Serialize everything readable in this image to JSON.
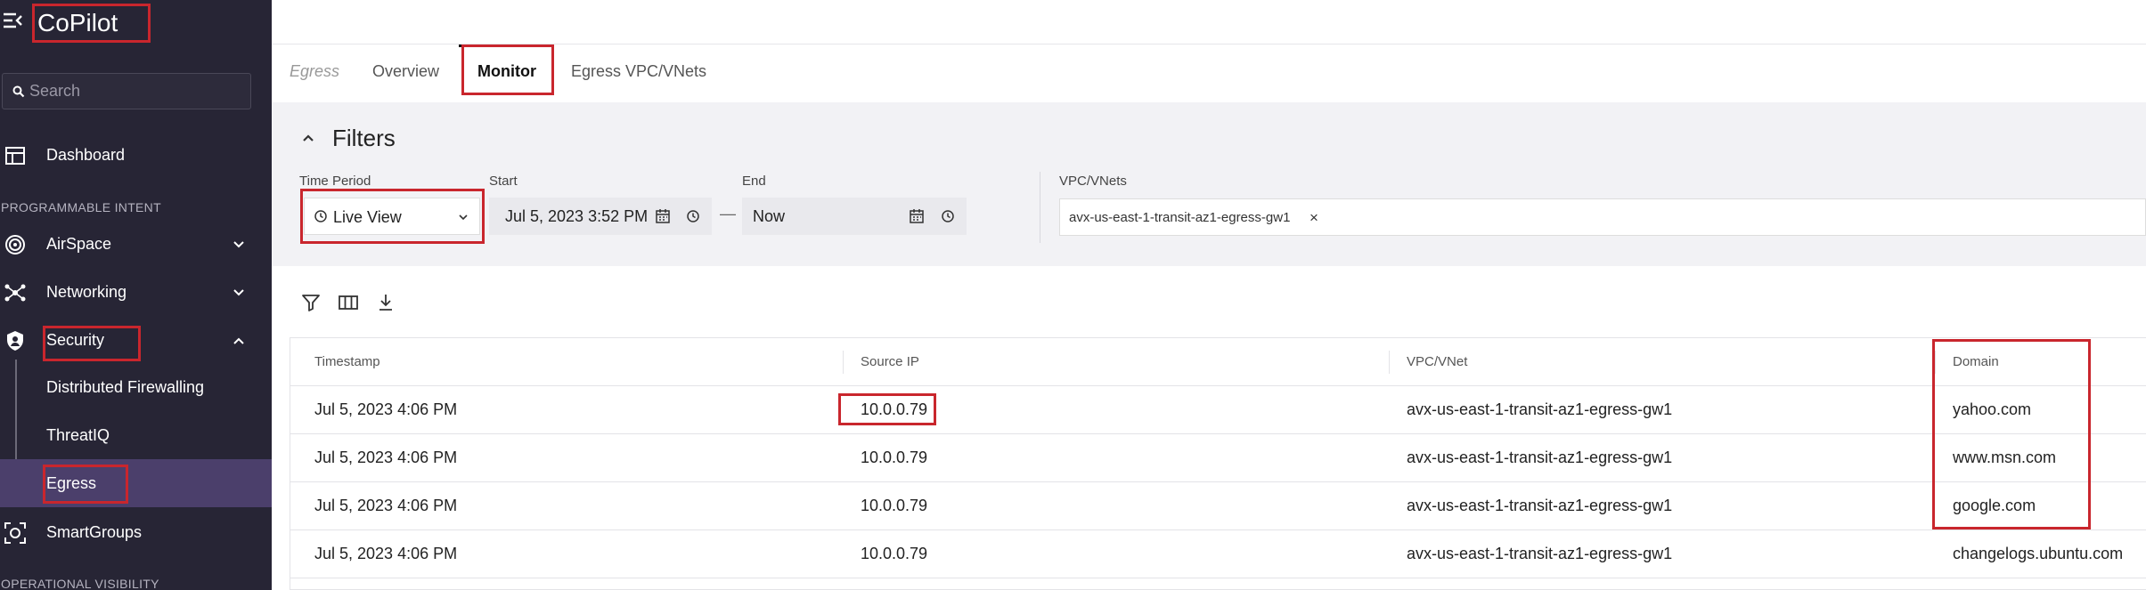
{
  "app": {
    "title": "CoPilot"
  },
  "search": {
    "placeholder": "Search"
  },
  "nav": {
    "dashboard": "Dashboard",
    "section_programmable": "PROGRAMMABLE INTENT",
    "airspace": "AirSpace",
    "networking": "Networking",
    "security": "Security",
    "security_items": [
      "Distributed Firewalling",
      "ThreatIQ",
      "Egress"
    ],
    "smartgroups": "SmartGroups",
    "section_operational": "OPERATIONAL VISIBILITY"
  },
  "tabs": {
    "breadcrumb": "Egress",
    "overview": "Overview",
    "monitor": "Monitor",
    "egress_vpc": "Egress VPC/VNets"
  },
  "filters": {
    "title": "Filters",
    "time_period_label": "Time Period",
    "time_period_value": "Live View",
    "start_label": "Start",
    "start_value": "Jul 5, 2023 3:52 PM",
    "end_label": "End",
    "end_value": "Now",
    "vpc_label": "VPC/VNets",
    "vpc_chip": "avx-us-east-1-transit-az1-egress-gw1",
    "vpc_chip_remove": "×"
  },
  "table": {
    "headers": [
      "Timestamp",
      "Source IP",
      "VPC/VNet",
      "Domain"
    ],
    "rows": [
      [
        "Jul 5, 2023 4:06 PM",
        "10.0.0.79",
        "avx-us-east-1-transit-az1-egress-gw1",
        "yahoo.com"
      ],
      [
        "Jul 5, 2023 4:06 PM",
        "10.0.0.79",
        "avx-us-east-1-transit-az1-egress-gw1",
        "www.msn.com"
      ],
      [
        "Jul 5, 2023 4:06 PM",
        "10.0.0.79",
        "avx-us-east-1-transit-az1-egress-gw1",
        "google.com"
      ],
      [
        "Jul 5, 2023 4:06 PM",
        "10.0.0.79",
        "avx-us-east-1-transit-az1-egress-gw1",
        "changelogs.ubuntu.com"
      ]
    ]
  },
  "colors": {
    "sidebar_bg": "#272535",
    "active_item_bg": "#4b3f6b",
    "highlight": "#c9262d",
    "filters_bg": "#f2f2f5"
  },
  "icons": [
    "menu-icon",
    "search-icon",
    "dashboard-icon",
    "airspace-icon",
    "networking-icon",
    "security-shield-icon",
    "smartgroups-icon",
    "chevron-up-icon",
    "clock-icon",
    "calendar-icon",
    "filter-icon",
    "columns-icon",
    "download-icon"
  ]
}
